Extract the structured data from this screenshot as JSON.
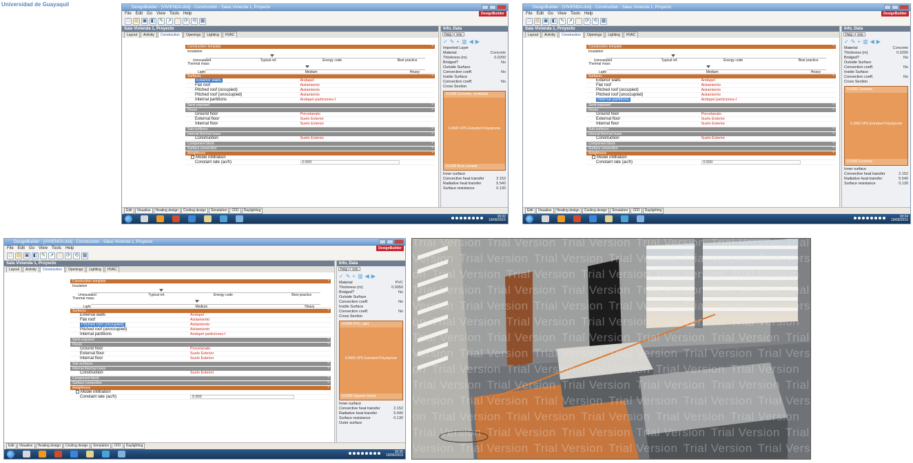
{
  "header_text": "Universidad de Guayaquil",
  "screenshots": [
    {
      "window_title": "DesignBuilder - [VIVIENDA.dsb] - Construction - Salas Vivienda 1, Proyecto",
      "menu": [
        "File",
        "Edit",
        "Go",
        "View",
        "Tools",
        "Help"
      ],
      "brand": "DesignBuilder",
      "breadcrumb": "Sala Vivienda 1, Proyecto",
      "tabs": [
        "Layout",
        "Activity",
        "Construction",
        "Openings",
        "Lighting",
        "HVAC"
      ],
      "active_tab": "Construction",
      "template_header": "Construction template",
      "slider1": {
        "caption": "Insulation",
        "labels": [
          "Uninsulated",
          "Typical ref.",
          "Energy code",
          "Best practice"
        ]
      },
      "slider2": {
        "caption": "Thermal mass",
        "labels": [
          "Light",
          "Medium",
          "Heavy"
        ]
      },
      "surfaces_header": "Surfaces",
      "surfaces": [
        {
          "label": "Exterior walls",
          "value": "Andapel"
        },
        {
          "label": "Flat roof",
          "value": "Aislamiento"
        },
        {
          "label": "Pitched roof (occupied)",
          "value": "Aislamiento"
        },
        {
          "label": "Pitched roof (unoccupied)",
          "value": "Aislamiento"
        },
        {
          "label": "Internal partitions",
          "value": "Andapel particiones-I"
        }
      ],
      "selected_surface": 0,
      "groups_mid": [
        "Semi-exposed",
        "Floors"
      ],
      "floors": [
        {
          "label": "Ground floor",
          "value": "Porcelanato"
        },
        {
          "label": "External floor",
          "value": "Suelo Exterior"
        },
        {
          "label": "Internal floor",
          "value": "Suelo Exterior"
        }
      ],
      "groups_low": [
        "Sub-surfaces",
        "Internal thermal mass"
      ],
      "construction": {
        "label": "Construction",
        "value": "Suelo Exterior"
      },
      "groups_end": [
        "Component block",
        "Surface convection",
        "Airtightness"
      ],
      "model_infiltration": "Model infiltration",
      "infiltration": {
        "label": "Constant rate (ac/h)",
        "value": "0.500"
      },
      "right_header": "Info, Data",
      "right_tabs": [
        "Help",
        "Info"
      ],
      "right_props": [
        {
          "label": "Imported Layer",
          "value": ""
        },
        {
          "label": "Material",
          "value": "Concrete"
        },
        {
          "label": "Thickness (m)",
          "value": "0.0200"
        },
        {
          "label": "Bridged?",
          "value": "No"
        },
        {
          "label": "Outside Surface",
          "value": ""
        },
        {
          "label": "Convection coeff.",
          "value": "No"
        },
        {
          "label": "Inside Surface",
          "value": ""
        },
        {
          "label": "Convection coeff.",
          "value": "No"
        },
        {
          "label": "Cross Section",
          "value": ""
        }
      ],
      "swatch": {
        "top": "0.0200  Concrete, ventilated",
        "mid": "0.0600  XPS Extruded Polystyrene",
        "bot": "0.0200  Brick ceramic"
      },
      "right_footer": [
        {
          "label": "Inner surface",
          "value": ""
        },
        {
          "label": "Convective heat transfer",
          "value": "2.152"
        },
        {
          "label": "Radiative heat transfer",
          "value": "5.540"
        },
        {
          "label": "Surface resistance",
          "value": "0.130"
        }
      ],
      "bottom_tabs": [
        "Edit",
        "Visualise",
        "Heating design",
        "Cooling design",
        "Simulation",
        "CFD",
        "Daylighting"
      ],
      "tray_time": "18:32",
      "tray_date": "19/06/2015"
    },
    {
      "window_title": "DesignBuilder - [VIVIENDA.dsb] - Construction - Salas Vivienda 1, Proyecto",
      "menu": [
        "File",
        "Edit",
        "Go",
        "View",
        "Tools",
        "Help"
      ],
      "brand": "DesignBuilder",
      "breadcrumb": "Sala Vivienda 1, Proyecto",
      "tabs": [
        "Layout",
        "Activity",
        "Construction",
        "Openings",
        "Lighting",
        "HVAC"
      ],
      "active_tab": "Construction",
      "template_header": "Construction template",
      "slider1": {
        "caption": "Insulation",
        "labels": [
          "Uninsulated",
          "Typical ref.",
          "Energy code",
          "Best practice"
        ]
      },
      "slider2": {
        "caption": "Thermal mass",
        "labels": [
          "Light",
          "Medium",
          "Heavy"
        ]
      },
      "surfaces_header": "Surfaces",
      "surfaces": [
        {
          "label": "Exterior walls",
          "value": "Andapel"
        },
        {
          "label": "Flat roof",
          "value": "Aislamiento"
        },
        {
          "label": "Pitched roof (occupied)",
          "value": "Aislamiento"
        },
        {
          "label": "Pitched roof (unoccupied)",
          "value": "Aislamiento"
        },
        {
          "label": "Internal partitions",
          "value": "Andapel particiones-I"
        }
      ],
      "selected_surface": 4,
      "groups_mid": [
        "Semi-exposed",
        "Floors"
      ],
      "floors": [
        {
          "label": "Ground floor",
          "value": "Porcelanato"
        },
        {
          "label": "External floor",
          "value": "Suelo Exterior"
        },
        {
          "label": "Internal floor",
          "value": "Suelo Exterior"
        }
      ],
      "groups_low": [
        "Sub-surfaces",
        "Internal thermal mass"
      ],
      "construction": {
        "label": "Construction",
        "value": "Suelo Exterior"
      },
      "groups_end": [
        "Component block",
        "Surface convection",
        "Airtightness"
      ],
      "model_infiltration": "Model infiltration",
      "infiltration": {
        "label": "Constant rate (ac/h)",
        "value": "0.500"
      },
      "right_header": "Info, Data",
      "right_tabs": [
        "Help",
        "Info"
      ],
      "right_props": [
        {
          "label": "Material",
          "value": "Concrete"
        },
        {
          "label": "Thickness (m)",
          "value": "0.0200"
        },
        {
          "label": "Bridged?",
          "value": "No"
        },
        {
          "label": "Outside Surface",
          "value": ""
        },
        {
          "label": "Convection coeff.",
          "value": "No"
        },
        {
          "label": "Inside Surface",
          "value": ""
        },
        {
          "label": "Convection coeff.",
          "value": "No"
        },
        {
          "label": "Cross Section",
          "value": ""
        }
      ],
      "swatch": {
        "top": "0.0200  Concrete",
        "mid": "0.1000  XPS Extruded Polystyrene",
        "bot": "0.0200  Concrete"
      },
      "right_footer": [
        {
          "label": "Inner surface",
          "value": ""
        },
        {
          "label": "Convective heat transfer",
          "value": "2.152"
        },
        {
          "label": "Radiative heat transfer",
          "value": "5.540"
        },
        {
          "label": "Surface resistance",
          "value": "0.130"
        }
      ],
      "bottom_tabs": [
        "Edit",
        "Visualise",
        "Heating design",
        "Cooling design",
        "Simulation",
        "CFD",
        "Daylighting"
      ],
      "tray_time": "18:34",
      "tray_date": "19/06/2015"
    },
    {
      "window_title": "DesignBuilder - [VIVIENDA.dsb] - Construction - Salas Vivienda 1, Proyecto",
      "menu": [
        "File",
        "Edit",
        "Go",
        "View",
        "Tools",
        "Help"
      ],
      "brand": "DesignBuilder",
      "breadcrumb": "Sala Vivienda 1, Proyecto",
      "tabs": [
        "Layout",
        "Activity",
        "Construction",
        "Openings",
        "Lighting",
        "HVAC"
      ],
      "active_tab": "Construction",
      "template_header": "Construction template",
      "slider1": {
        "caption": "Insulation",
        "labels": [
          "Uninsulated",
          "Typical ref.",
          "Energy code",
          "Best practice"
        ]
      },
      "slider2": {
        "caption": "Thermal mass",
        "labels": [
          "Light",
          "Medium",
          "Heavy"
        ]
      },
      "surfaces_header": "Surfaces",
      "surfaces": [
        {
          "label": "External walls",
          "value": "Andapel"
        },
        {
          "label": "Flat roof",
          "value": "Aislamiento"
        },
        {
          "label": "Pitched roof (occupied)",
          "value": "Aislamiento"
        },
        {
          "label": "Pitched roof (unoccupied)",
          "value": "Aislamiento"
        },
        {
          "label": "Internal partitions",
          "value": "Andapel particiones-I"
        }
      ],
      "selected_surface": 2,
      "groups_mid": [
        "Semi-exposed",
        "Floors"
      ],
      "floors": [
        {
          "label": "Ground floor",
          "value": "Porcelanato"
        },
        {
          "label": "External floor",
          "value": "Suelo Exterior"
        },
        {
          "label": "Internal floor",
          "value": "Suelo Exterior"
        }
      ],
      "groups_low": [
        "Sub-surfaces",
        "Internal thermal mass"
      ],
      "construction": {
        "label": "Construction",
        "value": "Suelo Exterior"
      },
      "groups_end": [
        "Component block",
        "Surface convection",
        "Airtightness"
      ],
      "model_infiltration": "Model infiltration",
      "infiltration": {
        "label": "Constant rate (ac/h)",
        "value": "0.500"
      },
      "right_header": "Info, Data",
      "right_tabs": [
        "Help",
        "Info"
      ],
      "right_props": [
        {
          "label": "Material",
          "value": "PVC"
        },
        {
          "label": "Thickness (m)",
          "value": "0.0050"
        },
        {
          "label": "Bridged?",
          "value": "No"
        },
        {
          "label": "Outside Surface",
          "value": ""
        },
        {
          "label": "Convection coeff.",
          "value": "No"
        },
        {
          "label": "Inside Surface",
          "value": ""
        },
        {
          "label": "Convection coeff.",
          "value": "No"
        },
        {
          "label": "Cross Section",
          "value": ""
        }
      ],
      "swatch": {
        "top": "0.0050  PVC, rigid",
        "mid": "0.0600  XPS Extruded Polystyrene",
        "bot": "0.0200  Gypsum board"
      },
      "right_footer": [
        {
          "label": "Inner surface",
          "value": ""
        },
        {
          "label": "Convective heat transfer",
          "value": "2.152"
        },
        {
          "label": "Radiative heat transfer",
          "value": "5.540"
        },
        {
          "label": "Surface resistance",
          "value": "0.130"
        },
        {
          "label": "Outer surface",
          "value": ""
        }
      ],
      "bottom_tabs": [
        "Edit",
        "Visualise",
        "Heating design",
        "Cooling design",
        "Simulation",
        "CFD",
        "Daylighting"
      ],
      "tray_time": "18:35",
      "tray_date": "19/06/2015"
    }
  ],
  "render_view": {
    "watermark": "Trial Version"
  }
}
